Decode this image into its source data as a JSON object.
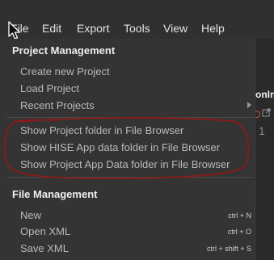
{
  "menubar": {
    "items": [
      "File",
      "Edit",
      "Export",
      "Tools",
      "View",
      "Help"
    ]
  },
  "dropdown": {
    "project_management": {
      "header": "Project Management",
      "items": [
        "Create new Project",
        "Load Project",
        "Recent Projects"
      ]
    },
    "folders": {
      "items": [
        "Show Project folder in File Browser",
        "Show HISE App data folder in File Browser",
        "Show Project App Data folder in File Browser"
      ]
    },
    "file_management": {
      "header": "File Management",
      "items": [
        {
          "label": "New",
          "shortcut": "ctrl + N"
        },
        {
          "label": "Open XML",
          "shortcut": "ctrl + O"
        },
        {
          "label": "Save XML",
          "shortcut": "ctrl + shift + S"
        }
      ]
    }
  },
  "editor": {
    "tab_fragment": "onIni",
    "line_number": "1"
  },
  "colors": {
    "menubar_bg": "#303030",
    "dropdown_bg": "#343434",
    "header_text": "#eeeeee",
    "item_text": "#b9b9b9",
    "annotation_circle": "#8b1a1a"
  }
}
